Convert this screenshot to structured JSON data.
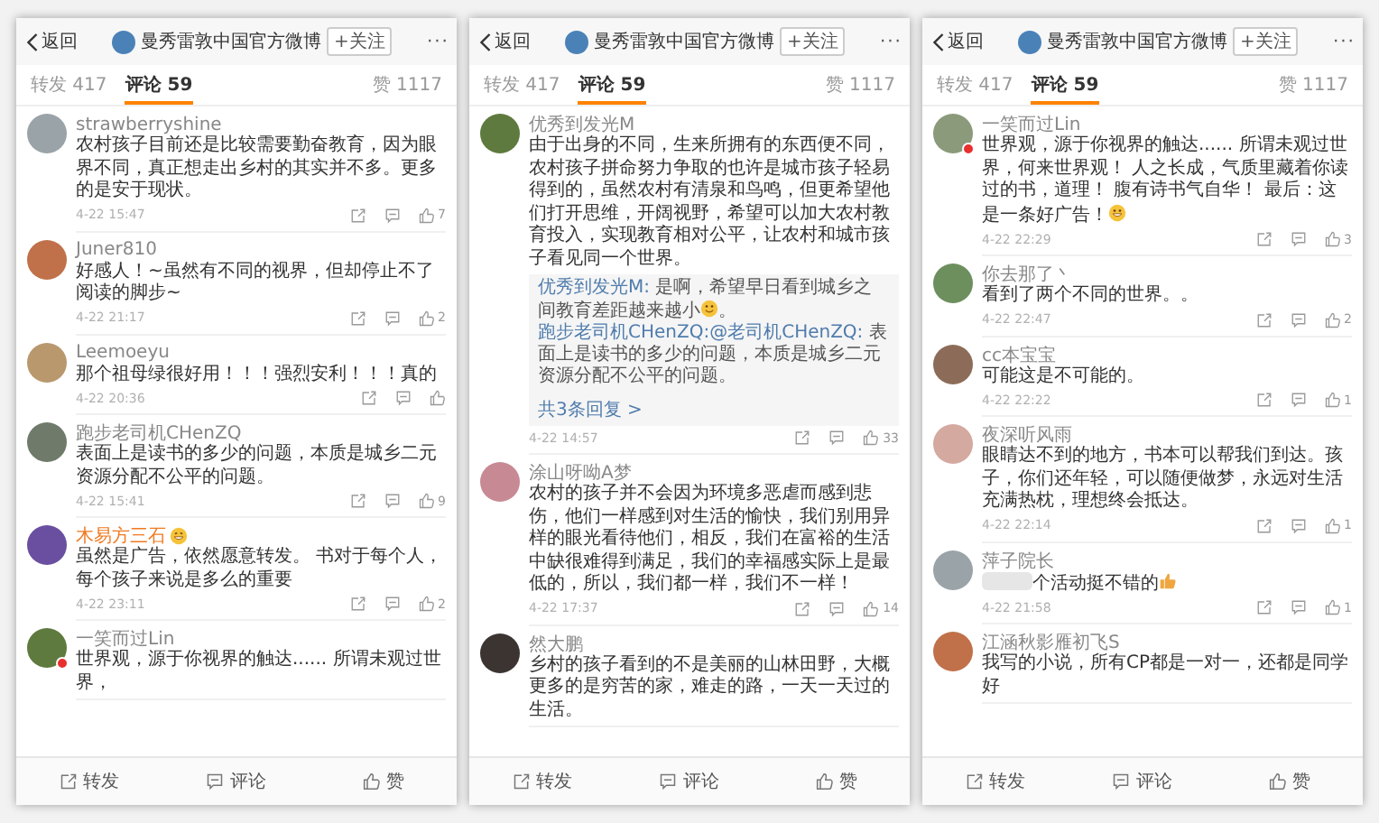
{
  "panels": [
    {
      "header": {
        "back": "返回",
        "title": "曼秀雷敦中国官方微博",
        "follow": "+关注",
        "more": "···"
      },
      "tabs": [
        {
          "label": "转发 417",
          "selected": false
        },
        {
          "label": "评论 59",
          "selected": true
        },
        {
          "label": "赞 1117",
          "selected": false
        }
      ],
      "comments": [
        {
          "user": "strawberryshine",
          "vip": false,
          "badge": false,
          "text": "农村孩子目前还是比较需要勤奋教育，因为眼界不同，真正想走出乡村的其实并不多。更多的是安于现状。",
          "time": "4-22 15:47",
          "likes": "7"
        },
        {
          "user": "Juner810",
          "vip": false,
          "badge": false,
          "text": "好感人！~虽然有不同的视界，但却停止不了阅读的脚步~",
          "time": "4-22 21:17",
          "likes": "2"
        },
        {
          "user": "Leemoeyu",
          "vip": false,
          "badge": false,
          "text": "那个祖母绿很好用！！！强烈安利！！！真的",
          "time": "4-22 20:36"
        },
        {
          "user": "跑步老司机CHenZQ",
          "vip": false,
          "badge": false,
          "text": "表面上是读书的多少的问题，本质是城乡二元资源分配不公平的问题。",
          "time": "4-22 15:41",
          "likes": "9"
        },
        {
          "user": "木易方三石",
          "vip": true,
          "name_emoji": {
            "kind": "grin"
          },
          "badge": false,
          "text": "虽然是广告，依然愿意转发。 书对于每个人，每个孩子来说是多么的重要",
          "time": "4-22 23:11",
          "likes": "2"
        },
        {
          "user": "一笑而过Lin",
          "vip": false,
          "badge": true,
          "text": "世界观，源于你视界的触达...... 所谓未观过世界，"
        }
      ],
      "bottom_bar": [
        "转发",
        "评论",
        "赞"
      ]
    },
    {
      "header": {
        "back": "返回",
        "title": "曼秀雷敦中国官方微博",
        "follow": "+关注",
        "more": "···"
      },
      "tabs": [
        {
          "label": "转发 417",
          "selected": false
        },
        {
          "label": "评论 59",
          "selected": true
        },
        {
          "label": "赞 1117",
          "selected": false
        }
      ],
      "comments": [
        {
          "user": "优秀到发光M",
          "vip": false,
          "badge": false,
          "text": "由于出身的不同，生来所拥有的东西便不同，农村孩子拼命努力争取的也许是城市孩子轻易得到的，虽然农村有清泉和鸟鸣，但更希望他们打开思维，开阔视野，希望可以加大农村教育投入，实现教育相对公平，让农村和城市孩子看见同一个世界。",
          "replies": [
            {
              "user": "优秀到发光M:",
              "text": " 是啊，希望早日看到城乡之间教育差距越来越小",
              "emoji": {
                "kind": "smile"
              },
              "text_after": "。"
            },
            {
              "user": "跑步老司机CHenZQ:",
              "mention": "@老司机CHenZQ:",
              "text": " 表面上是读书的多少的问题，本质是城乡二元资源分配不公平的问题。"
            }
          ],
          "more_replies": "共3条回复 >",
          "time": "4-22 14:57",
          "likes": "33"
        },
        {
          "user": "涂山呀呦A梦",
          "vip": false,
          "badge": false,
          "text": "农村的孩子并不会因为环境多恶虐而感到悲伤，他们一样感到对生活的愉快，我们别用异样的眼光看待他们，相反，我们在富裕的生活中缺很难得到满足，我们的幸福感实际上是最低的，所以，我们都一样，我们不一样！",
          "time": "4-22 17:37",
          "likes": "14"
        },
        {
          "user": "然大鹏",
          "vip": false,
          "badge": false,
          "text": "乡村的孩子看到的不是美丽的山林田野，大概更多的是穷苦的家，难走的路，一天一天过的生活。"
        }
      ],
      "bottom_bar": [
        "转发",
        "评论",
        "赞"
      ]
    },
    {
      "header": {
        "back": "返回",
        "title": "曼秀雷敦中国官方微博",
        "follow": "+关注",
        "more": "···"
      },
      "tabs": [
        {
          "label": "转发 417",
          "selected": false
        },
        {
          "label": "评论 59",
          "selected": true
        },
        {
          "label": "赞 1117",
          "selected": false
        }
      ],
      "comments": [
        {
          "user": "一笑而过Lin",
          "vip": false,
          "badge": true,
          "text": "世界观，源于你视界的触达...... 所谓未观过世界，何来世界观！ 人之长成，气质里藏着你读过的书，道理！ 腹有诗书气自华！ 最后：这是一条好广告！",
          "emoji": {
            "kind": "grin"
          },
          "time": "4-22 22:29",
          "likes": "3"
        },
        {
          "user": "你去那了丶",
          "vip": false,
          "badge": false,
          "text": "看到了两个不同的世界。。",
          "time": "4-22 22:47",
          "likes": "2"
        },
        {
          "user": "cc本宝宝",
          "vip": false,
          "badge": false,
          "text": "可能这是不可能的。",
          "time": "4-22 22:22",
          "likes": "1"
        },
        {
          "user": "夜深听风雨",
          "vip": false,
          "badge": false,
          "text": "眼睛达不到的地方，书本可以帮我们到达。孩子，你们还年轻，可以随便做梦，永远对生活充满热枕，理想终会抵达。",
          "time": "4-22 22:14",
          "likes": "1"
        },
        {
          "user": "萍子院长",
          "vip": false,
          "badge": false,
          "redacted": true,
          "text": "个活动挺不错的",
          "emoji": {
            "kind": "thumbs-up"
          },
          "time": "4-22 21:58",
          "likes": "1"
        },
        {
          "user": "江涵秋影雁初飞S",
          "vip": false,
          "badge": false,
          "text": "我写的小说，所有CP都是一对一，还都是同学好"
        }
      ],
      "bottom_bar": [
        "转发",
        "评论",
        "赞"
      ]
    }
  ]
}
